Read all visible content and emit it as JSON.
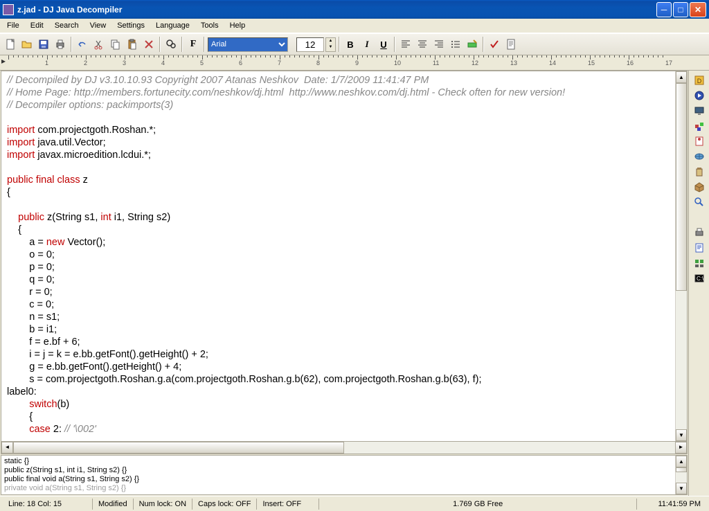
{
  "title": "z.jad - DJ Java Decompiler",
  "menu": [
    "File",
    "Edit",
    "Search",
    "View",
    "Settings",
    "Language",
    "Tools",
    "Help"
  ],
  "font": {
    "name": "Arial",
    "size": "12"
  },
  "code": {
    "c1": "// Decompiled by DJ v3.10.10.93 Copyright 2007 Atanas Neshkov  Date: 1/7/2009 11:41:47 PM",
    "c2": "// Home Page: http://members.fortunecity.com/neshkov/dj.html  http://www.neshkov.com/dj.html - Check often for new version!",
    "c3": "// Decompiler options: packimports(3) ",
    "imp": "import",
    "i1": " com.projectgoth.Roshan.*;",
    "i2": " java.util.Vector;",
    "i3": " javax.microedition.lcdui.*;",
    "pfc": "public final class",
    "cls": " z",
    "pub": "public",
    "int": "int",
    "ctor": " z(String s1, ",
    "ctor2": " i1, String s2)",
    "new": "new",
    "vec": " Vector();",
    "a1": "        a = ",
    "a2": "        o = 0;",
    "a3": "        p = 0;",
    "a4": "        q = 0;",
    "a5": "        r = 0;",
    "a6": "        c = 0;",
    "a7": "        n = s1;",
    "a8": "        b = i1;",
    "a9": "        f = e.bf + 6;",
    "a10": "        i = j = k = e.bb.getFont().getHeight() + 2;",
    "a11": "        g = e.bb.getFont().getHeight() + 4;",
    "a12": "        s = com.projectgoth.Roshan.g.a(com.projectgoth.Roshan.g.b(62), com.projectgoth.Roshan.g.b(63), f);",
    "lbl": "label0:",
    "sw": "switch",
    "swb": "(b)",
    "case": "case",
    "cv": " 2: ",
    "cc": "// '\\002'",
    "ob": "{",
    "cb": "}"
  },
  "outline": {
    "l1": "static  {}",
    "l2": "public z(String s1, int i1, String s2) {}",
    "l3": "public final void a(String s1, String s2) {}",
    "l4": "private void a(String s1, String s2) {}"
  },
  "status": {
    "pos": "Line:  18  Col:  15",
    "mod": "Modified",
    "num": "Num lock: ON",
    "caps": "Caps lock: OFF",
    "ins": "Insert: OFF",
    "free": "1.769 GB Free",
    "time": "11:41:59 PM"
  }
}
